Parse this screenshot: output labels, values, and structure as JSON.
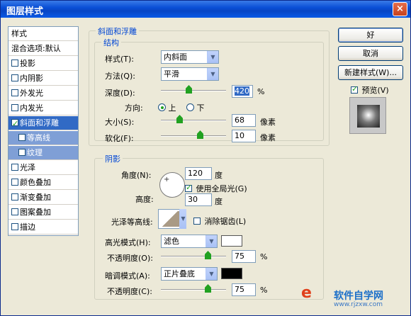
{
  "window": {
    "title": "图层样式",
    "close_label": "×"
  },
  "left_panel": {
    "header": "样式",
    "blend": "混合选项:默认",
    "items": [
      {
        "label": "投影",
        "checked": false
      },
      {
        "label": "内阴影",
        "checked": false
      },
      {
        "label": "外发光",
        "checked": false
      },
      {
        "label": "内发光",
        "checked": false
      },
      {
        "label": "斜面和浮雕",
        "checked": true
      },
      {
        "label": "等高线",
        "checked": false
      },
      {
        "label": "纹理",
        "checked": false
      },
      {
        "label": "光泽",
        "checked": false
      },
      {
        "label": "颜色叠加",
        "checked": false
      },
      {
        "label": "渐变叠加",
        "checked": false
      },
      {
        "label": "图案叠加",
        "checked": false
      },
      {
        "label": "描边",
        "checked": false
      }
    ]
  },
  "bevel": {
    "group_title": "斜面和浮雕",
    "structure_title": "结构",
    "style_label": "样式(T):",
    "style_value": "内斜面",
    "technique_label": "方法(Q):",
    "technique_value": "平滑",
    "depth_label": "深度(D):",
    "depth_value": "420",
    "depth_unit": "%",
    "depth_fraction": 0.42,
    "direction_label": "方向:",
    "dir_up": "上",
    "dir_down": "下",
    "size_label": "大小(S):",
    "size_value": "68",
    "size_unit": "像素",
    "size_fraction": 0.27,
    "soften_label": "软化(F):",
    "soften_value": "10",
    "soften_unit": "像素",
    "soften_fraction": 0.62
  },
  "shading": {
    "title": "阴影",
    "angle_label": "角度(N):",
    "angle_value": "120",
    "angle_unit": "度",
    "global_light_label": "使用全局光(G)",
    "altitude_label": "高度:",
    "altitude_value": "30",
    "altitude_unit": "度",
    "gloss_label": "光泽等高线:",
    "antialias_label": "消除锯齿(L)",
    "highlight_mode_label": "高光模式(H):",
    "highlight_mode_value": "滤色",
    "highlight_color": "#ffffff",
    "highlight_opacity_label": "不透明度(O):",
    "highlight_opacity_value": "75",
    "highlight_opacity_fraction": 0.75,
    "shadow_mode_label": "暗调模式(A):",
    "shadow_mode_value": "正片叠底",
    "shadow_color": "#000000",
    "shadow_opacity_label": "不透明度(C):",
    "shadow_opacity_value": "75",
    "shadow_opacity_fraction": 0.75,
    "percent": "%"
  },
  "buttons": {
    "ok": "好",
    "cancel": "取消",
    "new_style": "新建样式(W)...",
    "preview": "预览(V)"
  },
  "watermark": {
    "brand": "软件自学网",
    "url": "www.rjzxw.com"
  }
}
